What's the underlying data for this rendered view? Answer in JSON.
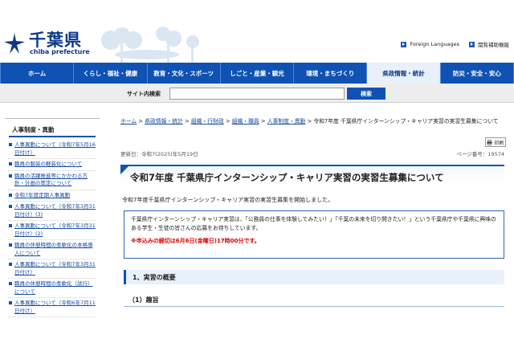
{
  "header": {
    "logo_ja": "千葉県",
    "logo_en": "chiba prefecture",
    "util_links": [
      "Foreign Languages",
      "閲覧補助機能"
    ]
  },
  "nav": {
    "items": [
      "ホーム",
      "くらし・福祉・健康",
      "教育・文化・スポーツ",
      "しごと・産業・観光",
      "環境・まちづくり",
      "県政情報・統計",
      "防災・安全・安心"
    ],
    "active_index": 5
  },
  "search": {
    "label": "サイト内検索",
    "value": "",
    "button_label": "検索"
  },
  "sidebar": {
    "title": "人事制度・異動",
    "items": [
      "人事異動について（令和7年5月16日付け）",
      "職員の服装の軽装化について",
      "職員の活躍推進等にかかわる方針・計画の策定について",
      "令和7年度定期人事異動",
      "人事異動について（令和7年3月31日付け）(3)",
      "人事異動について（令和7年3月31日付け）(2)",
      "職員の休憩時間の柔軟化の本格導入について",
      "人事異動について（令和7年3月31日付け）",
      "職員の休憩時間の柔軟化（試行）について",
      "人事異動について（令和6年7月11日付け）"
    ]
  },
  "breadcrumb": {
    "links": [
      "ホーム",
      "県政情報・統計",
      "組織・行財政",
      "組織・職員",
      "人事制度・異動"
    ],
    "separator": ">",
    "current": "令和7年度 千葉県庁インターンシップ・キャリア実習の実習生募集について"
  },
  "meta": {
    "updated": "更新日：令和7(2025)年5月19日",
    "print_label": "印刷",
    "page_number": "ページ番号：19574"
  },
  "article": {
    "title": "令和7年度 千葉県庁インターンシップ・キャリア実習の実習生募集について",
    "lead": "令和7年度千葉県庁インターンシップ・キャリア実習の実習生募集を開始しました。",
    "info_text": "千葉県庁インターンシップ・キャリア実習は、「公務員の仕事を体験してみたい！」「千葉の未来を切り開きたい！」という千葉県庁や千葉県に興味のある学生・生徒の皆さんの応募をお待ちしています。",
    "deadline": "※申込みの締切は6月6日(金曜日)17時00分です。",
    "section_1": "1、実習の概要",
    "sub_1": "（1）趣旨"
  },
  "colors": {
    "brand_blue": "#0f52b3",
    "deadline_red": "#d60000"
  }
}
